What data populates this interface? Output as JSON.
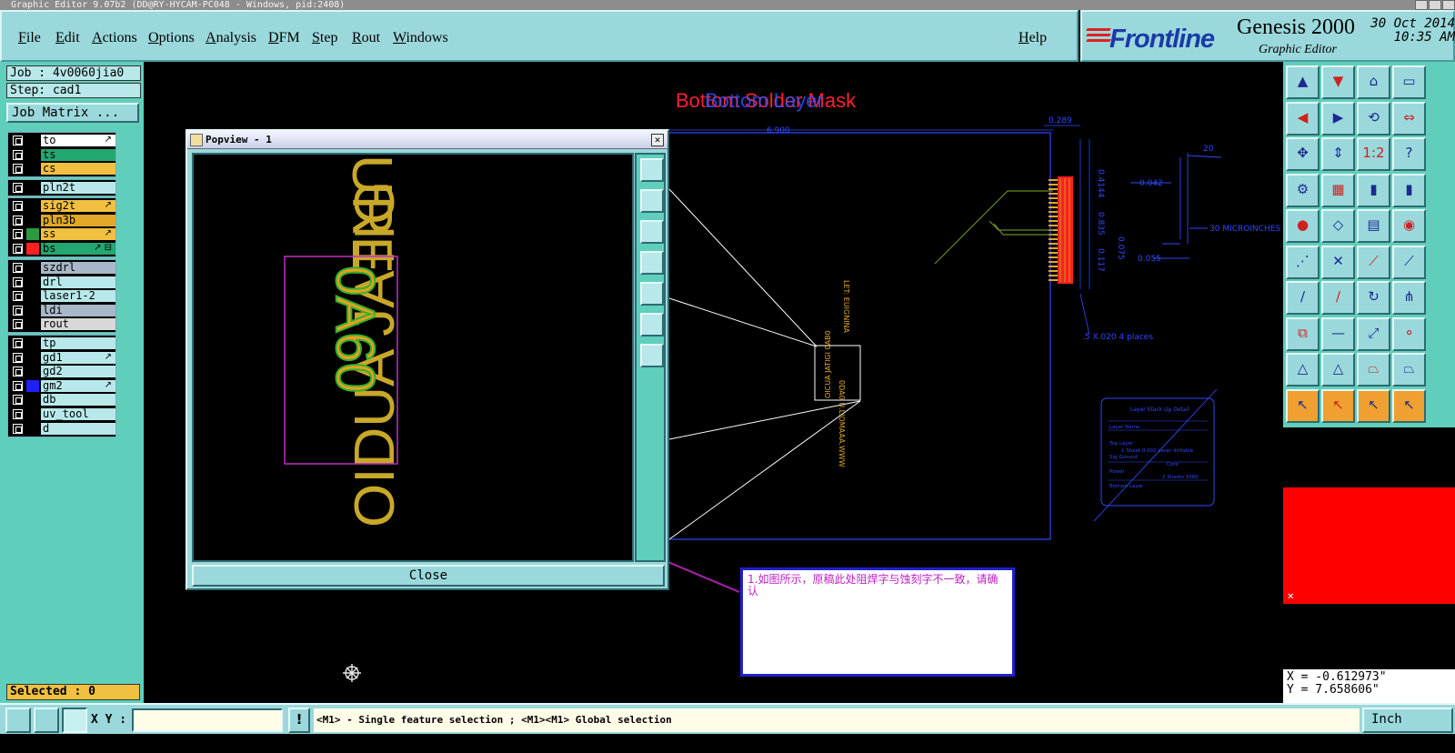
{
  "window": {
    "title": "Graphic Editor 9.07b2 (DD@RY-HYCAM-PC048 - Windows, pid:2408)"
  },
  "menu": {
    "items": [
      "File",
      "Edit",
      "Actions",
      "Options",
      "Analysis",
      "DFM",
      "Step",
      "Rout",
      "Windows"
    ],
    "help": "Help"
  },
  "brand": {
    "logo": "Frontline",
    "product": "Genesis 2000",
    "subtitle": "Graphic Editor",
    "date": "30 Oct 2014",
    "time": "10:35 AM"
  },
  "job": {
    "job_line": "Job : 4v0060jia0",
    "step_line": "Step: cad1",
    "job_matrix_label": "Job Matrix ..."
  },
  "layers": {
    "group1": [
      {
        "name": "to",
        "color": "#ffffff",
        "mark": "↗"
      },
      {
        "name": "ts",
        "color": "#22a870",
        "mark": ""
      },
      {
        "name": "cs",
        "color": "#f2c040",
        "mark": ""
      }
    ],
    "group2": [
      {
        "name": "pln2t",
        "color": "#b8e8ea",
        "mark": ""
      }
    ],
    "group3": [
      {
        "name": "sig2t",
        "color": "#f2c040",
        "mark": "↗"
      },
      {
        "name": "pln3b",
        "color": "#e0a828",
        "mark": ""
      },
      {
        "name": "ss",
        "color": "#f2c040",
        "mark": "↗",
        "swatch": "#2a9a40"
      },
      {
        "name": "bs",
        "color": "#22a870",
        "mark": "↗ ⊟",
        "swatch": "#ff2020",
        "active": true
      }
    ],
    "group4": [
      {
        "name": "szdrl",
        "color": "#a8b8c8",
        "mark": ""
      },
      {
        "name": "drl",
        "color": "#b8e8ea",
        "mark": ""
      },
      {
        "name": "laser1-2",
        "color": "#b8e8ea",
        "mark": ""
      },
      {
        "name": "ldi",
        "color": "#a8b8c8",
        "mark": ""
      },
      {
        "name": "rout",
        "color": "#d8d8d8",
        "mark": ""
      }
    ],
    "group5": [
      {
        "name": "tp",
        "color": "#b8e8ea",
        "mark": ""
      },
      {
        "name": "gd1",
        "color": "#b8e8ea",
        "mark": "↗"
      },
      {
        "name": "gd2",
        "color": "#b8e8ea",
        "mark": ""
      },
      {
        "name": "gm2",
        "color": "#b8e8ea",
        "mark": "↗",
        "swatch": "#2020ff"
      },
      {
        "name": "db",
        "color": "#b8e8ea",
        "mark": ""
      },
      {
        "name": "uv_tool",
        "color": "#b8e8ea",
        "mark": ""
      },
      {
        "name": "d",
        "color": "#b8e8ea",
        "mark": ""
      }
    ]
  },
  "selected_label": "Selected : 0",
  "canvas": {
    "layer_title_1": "Bottom Solder Mask",
    "layer_title_2": "Bottom Layer",
    "dims": [
      "0.289",
      "6.900",
      "0.4144",
      "0.835",
      "0.075",
      "0.117",
      "0.055",
      "0.042",
      "20",
      "30 MICROINCHES",
      ".5 X.020 4 places"
    ],
    "stackup_title": "Layer Stack Up Detail",
    "stackup_rows": [
      "Layer Name",
      "Top Layer",
      "1 Sheet 0.002 Laser drillable",
      "Sig-Ground",
      "Core",
      "Power",
      "2 Sheets 1080",
      "Bottom Layer"
    ]
  },
  "popview": {
    "title": "Popview - 1",
    "close_label": "Close",
    "text_fragments": [
      "URE",
      "0A60",
      "OIDUA JATIG"
    ]
  },
  "note": {
    "text": "1.如图所示，原稿此处阻焊字与蚀刻字不一致，请确认"
  },
  "coords": {
    "x": "X = -0.612973\"",
    "y": "Y = 7.658606\""
  },
  "bottom": {
    "xy_label": "X Y :",
    "xy_value": "",
    "excl_label": "!",
    "prompt": "<M1> - Single feature selection ; <M1><M1> Global selection",
    "units": "Inch"
  },
  "colors": {
    "panel": "#9ad8db",
    "panel_dark": "#5fcfbc",
    "minimap": "#ff0000",
    "note_text": "#c020c0"
  }
}
